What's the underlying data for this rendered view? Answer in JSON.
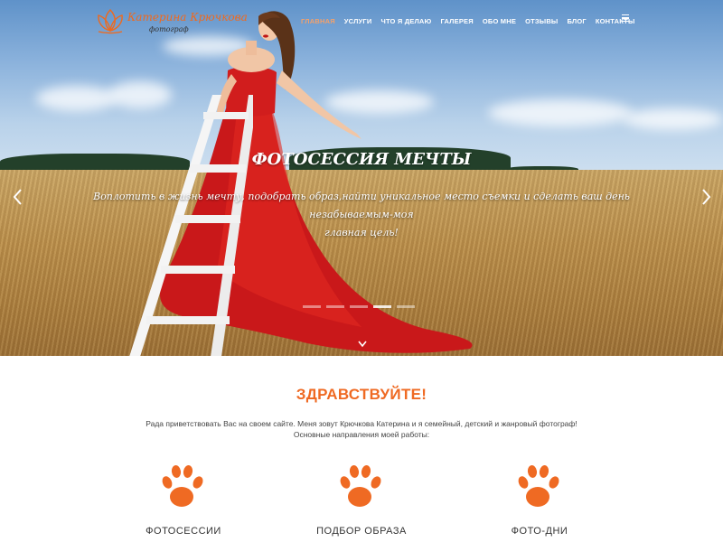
{
  "header": {
    "logo_name": "Катерина Крючкова",
    "logo_sub": "фотограф",
    "nav": [
      {
        "label": "ГЛАВНАЯ",
        "active": true
      },
      {
        "label": "УСЛУГИ",
        "active": false
      },
      {
        "label": "ЧТО Я ДЕЛАЮ",
        "active": false
      },
      {
        "label": "ГАЛЕРЕЯ",
        "active": false
      },
      {
        "label": "ОБО МНЕ",
        "active": false
      },
      {
        "label": "ОТЗЫВЫ",
        "active": false
      },
      {
        "label": "БЛОГ",
        "active": false
      },
      {
        "label": "КОНТАКТЫ",
        "active": false
      }
    ],
    "menu_icon": "hamburger-icon"
  },
  "hero": {
    "title": "ФОТОСЕССИЯ МЕЧТЫ",
    "text_line1": "Воплотить в жизнь мечту, подобрать образ,найти уникальное место съемки и сделать ваш день незабываемым-моя",
    "text_line2": "главная цель!",
    "prev_icon": "chevron-left-icon",
    "next_icon": "chevron-right-icon",
    "scroll_icon": "chevron-down-icon",
    "slides_count": 5,
    "active_slide": 1
  },
  "content": {
    "greeting": "ЗДРАВСТВУЙТЕ!",
    "intro_line1": "Рада приветствовать Вас на своем сайте. Меня зовут Крючкова Катерина и я семейный, детский и жанровый фотограф!",
    "intro_line2": "Основные направления моей работы:",
    "features": [
      {
        "label": "ФОТОСЕССИИ",
        "icon": "paw-icon"
      },
      {
        "label": "ПОДБОР ОБРАЗА",
        "icon": "paw-icon"
      },
      {
        "label": "ФОТО-ДНИ",
        "icon": "paw-icon"
      }
    ]
  },
  "colors": {
    "accent": "#ef6a23",
    "nav_active": "#f4a16b",
    "dress": "#d81e1e",
    "text": "#444444"
  }
}
